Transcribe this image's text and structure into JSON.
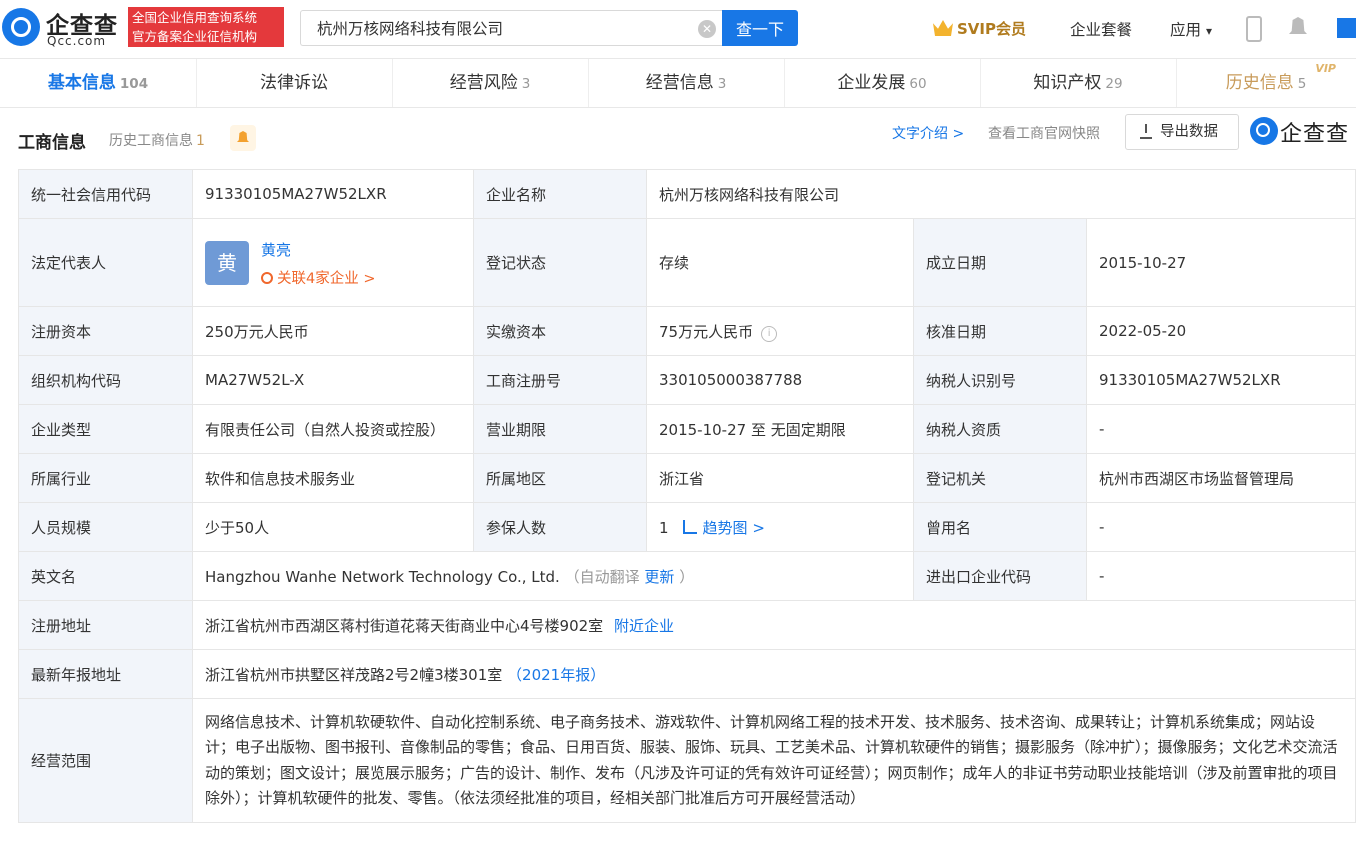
{
  "header": {
    "logo_text": "企查查",
    "logo_sub": "Qcc.com",
    "banner_line1": "全国企业信用查询系统",
    "banner_line2": "官方备案企业征信机构",
    "search_value": "杭州万核网络科技有限公司",
    "search_button": "查一下",
    "svip": "SVIP会员",
    "package": "企业套餐",
    "apps": "应用",
    "apps_caret": "▾"
  },
  "tabs": [
    {
      "label": "基本信息",
      "count": "104"
    },
    {
      "label": "法律诉讼",
      "count": ""
    },
    {
      "label": "经营风险",
      "count": "3"
    },
    {
      "label": "经营信息",
      "count": "3"
    },
    {
      "label": "企业发展",
      "count": "60"
    },
    {
      "label": "知识产权",
      "count": "29"
    },
    {
      "label": "历史信息",
      "count": "5",
      "badge": "VIP"
    }
  ],
  "section": {
    "title": "工商信息",
    "history_label": "历史工商信息",
    "history_count": "1",
    "text_intro": "文字介绍 >",
    "gov_snapshot": "查看工商官网快照",
    "export": "导出数据",
    "logo_text": "企查查"
  },
  "info": {
    "credit_code_label": "统一社会信用代码",
    "credit_code": "91330105MA27W52LXR",
    "name_label": "企业名称",
    "name": "杭州万核网络科技有限公司",
    "rep_label": "法定代表人",
    "rep_avatar": "黄",
    "rep_name": "黄亮",
    "rep_related": "关联4家企业 >",
    "status_label": "登记状态",
    "status": "存续",
    "founded_label": "成立日期",
    "founded": "2015-10-27",
    "reg_capital_label": "注册资本",
    "reg_capital": "250万元人民币",
    "paid_capital_label": "实缴资本",
    "paid_capital": "75万元人民币",
    "approved_label": "核准日期",
    "approved": "2022-05-20",
    "org_code_label": "组织机构代码",
    "org_code": "MA27W52L-X",
    "reg_no_label": "工商注册号",
    "reg_no": "330105000387788",
    "taxpayer_id_label": "纳税人识别号",
    "taxpayer_id": "91330105MA27W52LXR",
    "type_label": "企业类型",
    "type": "有限责任公司（自然人投资或控股）",
    "term_label": "营业期限",
    "term": "2015-10-27 至 无固定期限",
    "taxpayer_qual_label": "纳税人资质",
    "taxpayer_qual": "-",
    "industry_label": "所属行业",
    "industry": "软件和信息技术服务业",
    "region_label": "所属地区",
    "region": "浙江省",
    "authority_label": "登记机关",
    "authority": "杭州市西湖区市场监督管理局",
    "staff_label": "人员规模",
    "staff": "少于50人",
    "insured_label": "参保人数",
    "insured": "1",
    "trend": "趋势图 >",
    "former_name_label": "曾用名",
    "former_name": "-",
    "english_label": "英文名",
    "english": "Hangzhou Wanhe Network Technology Co., Ltd.",
    "auto_translate": "（自动翻译",
    "update": "更新",
    "close_paren": "）",
    "import_export_label": "进出口企业代码",
    "import_export": "-",
    "address_label": "注册地址",
    "address": "浙江省杭州市西湖区蒋村街道花蒋天街商业中心4号楼902室",
    "nearby": "附近企业",
    "annual_address_label": "最新年报地址",
    "annual_address": "浙江省杭州市拱墅区祥茂路2号2幢3楼301室",
    "annual_year": "（2021年报）",
    "scope_label": "经营范围",
    "scope": "网络信息技术、计算机软硬软件、自动化控制系统、电子商务技术、游戏软件、计算机网络工程的技术开发、技术服务、技术咨询、成果转让；计算机系统集成；网站设计；电子出版物、图书报刊、音像制品的零售；食品、日用百货、服装、服饰、玩具、工艺美术品、计算机软硬件的销售；摄影服务（除冲扩）；摄像服务；文化艺术交流活动的策划；图文设计；展览展示服务；广告的设计、制作、发布（凡涉及许可证的凭有效许可证经营）；网页制作；成年人的非证书劳动职业技能培训（涉及前置审批的项目除外）；计算机软硬件的批发、零售。（依法须经批准的项目，经相关部门批准后方可开展经营活动）"
  }
}
